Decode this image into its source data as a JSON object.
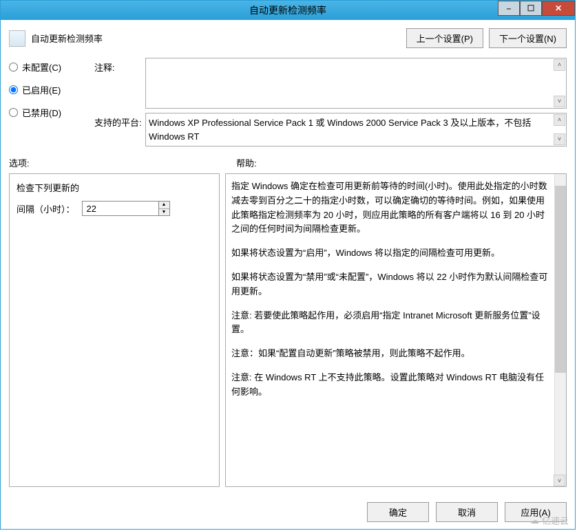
{
  "window": {
    "title": "自动更新检测频率",
    "min_label": "–",
    "max_label": "☐",
    "close_label": "✕"
  },
  "header": {
    "title": "自动更新检测频率",
    "prev_button": "上一个设置(P)",
    "next_button": "下一个设置(N)"
  },
  "radios": {
    "not_configured": "未配置(C)",
    "enabled": "已启用(E)",
    "disabled": "已禁用(D)"
  },
  "labels": {
    "comment": "注释:",
    "supported": "支持的平台:",
    "options": "选项:",
    "help": "帮助:"
  },
  "comment_text": "",
  "supported_text": "Windows XP Professional Service Pack 1 或 Windows 2000 Service Pack 3 及以上版本，不包括 Windows RT",
  "options": {
    "check_label": "检查下列更新的",
    "interval_label": "间隔（小时）：",
    "interval_value": "22"
  },
  "help": {
    "p1": "指定 Windows 确定在检查可用更新前等待的时间(小时)。使用此处指定的小时数减去零到百分之二十的指定小时数，可以确定确切的等待时间。例如，如果使用此策略指定检测频率为 20 小时，则应用此策略的所有客户端将以 16 到 20 小时之间的任何时间为间隔检查更新。",
    "p2": "如果将状态设置为“启用”，Windows 将以指定的间隔检查可用更新。",
    "p3": "如果将状态设置为“禁用”或“未配置”，Windows 将以 22 小时作为默认间隔检查可用更新。",
    "p4": "注意: 若要使此策略起作用，必须启用“指定 Intranet Microsoft 更新服务位置”设置。",
    "p5": "注意：如果“配置自动更新”策略被禁用，则此策略不起作用。",
    "p6": "注意: 在 Windows RT 上不支持此策略。设置此策略对 Windows RT 电脑没有任何影响。"
  },
  "footer": {
    "ok": "确定",
    "cancel": "取消",
    "apply": "应用(A)"
  },
  "watermark": "亿速云"
}
